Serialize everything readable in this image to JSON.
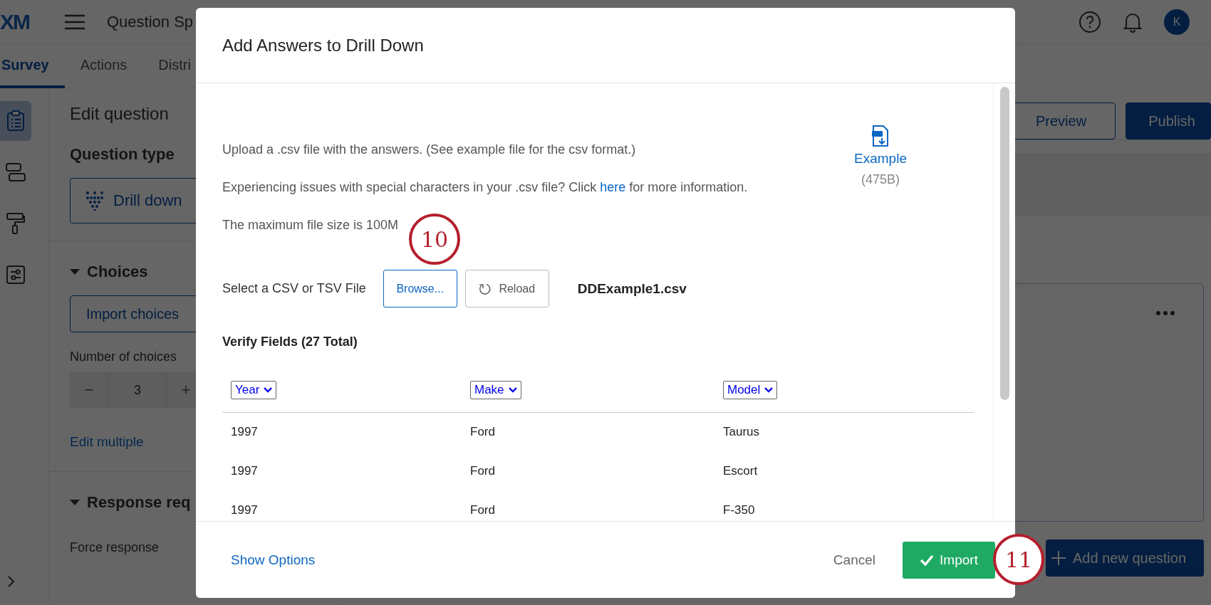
{
  "app_bar": {
    "logo": "XM",
    "title": "Question Sp",
    "avatar": "K"
  },
  "tabs": [
    {
      "label": "Survey",
      "selected": true
    },
    {
      "label": "Actions",
      "selected": false
    },
    {
      "label": "Distri",
      "selected": false
    }
  ],
  "rail": [
    {
      "kind": "survey",
      "selected": true
    },
    {
      "kind": "blocks",
      "selected": false
    },
    {
      "kind": "look",
      "selected": false
    },
    {
      "kind": "options",
      "selected": false
    }
  ],
  "edit_panel": {
    "heading": "Edit question",
    "question_type_label": "Question type",
    "question_type": "Drill down",
    "choices_heading": "Choices",
    "import_button": "Import choices",
    "number_label": "Number of choices",
    "stepper_minus": "−",
    "number_value": "3",
    "stepper_plus": "+",
    "edit_multiple": "Edit multiple",
    "response_heading": "Response req",
    "force_response": "Force response"
  },
  "toolbar": [
    {
      "label": "Preview",
      "kind": "outline"
    },
    {
      "label": "Publish",
      "kind": "primary"
    }
  ],
  "add_question": "Add new question",
  "dialog": {
    "title": "Add Answers to Drill Down",
    "intro": "Upload a .csv file with the answers. (See example file for the csv format.)",
    "issues_before": "Experiencing issues with special characters in your .csv file? Click ",
    "issues_link": "here",
    "issues_after": " for more information.",
    "max_size": "The maximum file size is 100M",
    "example": {
      "label": "Example",
      "size": "(475B)"
    },
    "select_label": "Select a CSV or TSV File",
    "browse": "Browse...",
    "reload": "Reload",
    "file_name": "DDExample1.csv",
    "verify_heading": "Verify Fields (27 Total)",
    "columns": [
      "Year",
      "Make",
      "Model"
    ],
    "rows": [
      [
        "1997",
        "Ford",
        "Taurus"
      ],
      [
        "1997",
        "Ford",
        "Escort"
      ],
      [
        "1997",
        "Ford",
        "F-350"
      ]
    ],
    "show_options": "Show Options",
    "cancel": "Cancel",
    "import": "Import"
  },
  "callouts": [
    "10",
    "11"
  ]
}
